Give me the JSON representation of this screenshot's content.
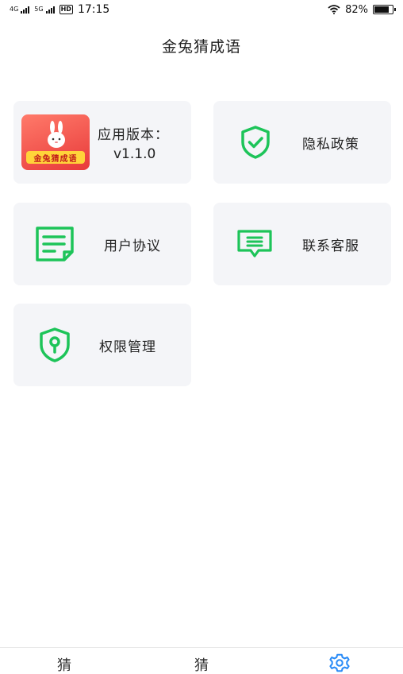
{
  "status_bar": {
    "net1": "4G",
    "net2": "5G",
    "hd": "HD",
    "time": "17:15",
    "battery": "82%",
    "battery_level": 0.82
  },
  "header": {
    "title": "金兔猜成语"
  },
  "cards": {
    "version": {
      "label": "应用版本：",
      "value": "v1.1.0",
      "app_badge": "金兔猜成语"
    },
    "privacy": {
      "label": "隐私政策"
    },
    "agreement": {
      "label": "用户协议"
    },
    "service": {
      "label": "联系客服"
    },
    "permission": {
      "label": "权限管理"
    }
  },
  "tabbar": {
    "tab1": "猜",
    "tab2": "猜"
  },
  "colors": {
    "accent": "#1dc459",
    "card_bg": "#f4f5f8"
  }
}
